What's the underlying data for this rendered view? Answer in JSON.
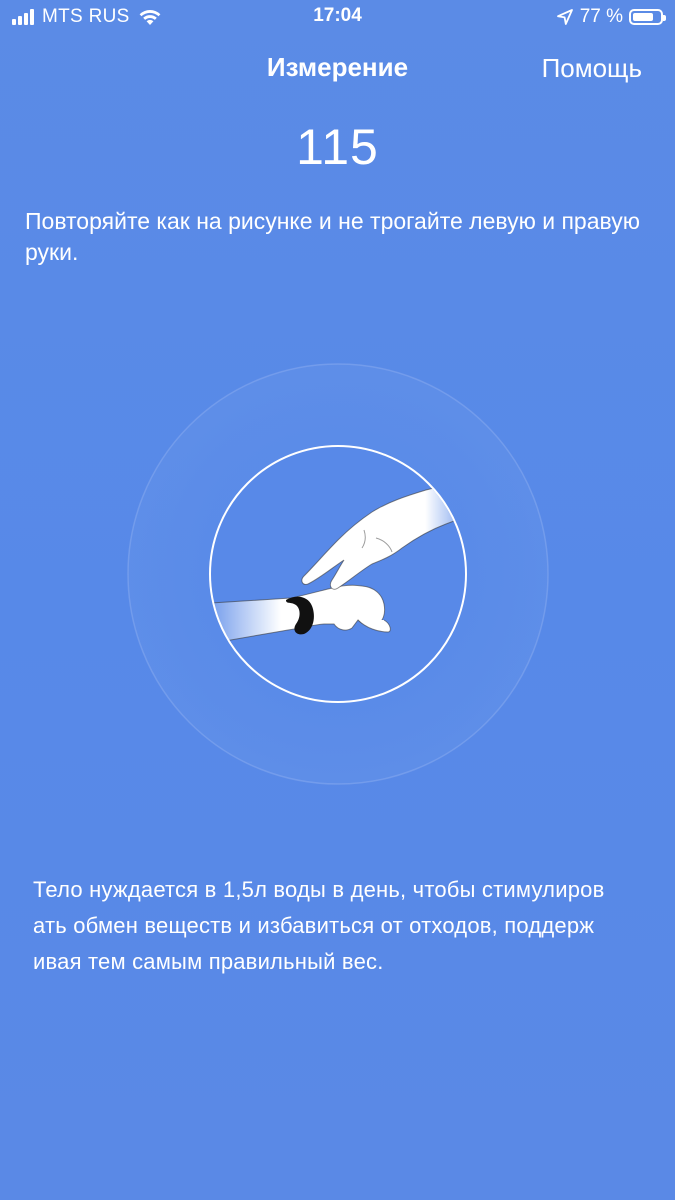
{
  "status_bar": {
    "carrier": "MTS RUS",
    "time": "17:04",
    "battery_percent": "77 %",
    "battery_level": 0.77,
    "icons": [
      "signal-icon",
      "wifi-icon",
      "location-icon",
      "battery-icon"
    ]
  },
  "nav": {
    "title": "Измерение",
    "help_label": "Помощь"
  },
  "measurement": {
    "value": "115"
  },
  "instruction": "Повторяйте как на рисунке и не трогайте левую и правую руки.",
  "tip": {
    "lines": [
      "Тело нуждается в 1,5л воды в день, чтобы стимулиров",
      "ать обмен веществ и избавиться от отходов, поддерж",
      "ивая тем самым правильный вес."
    ]
  },
  "colors": {
    "background": "#5b8ae6",
    "text": "#ffffff",
    "band": "#111111"
  }
}
